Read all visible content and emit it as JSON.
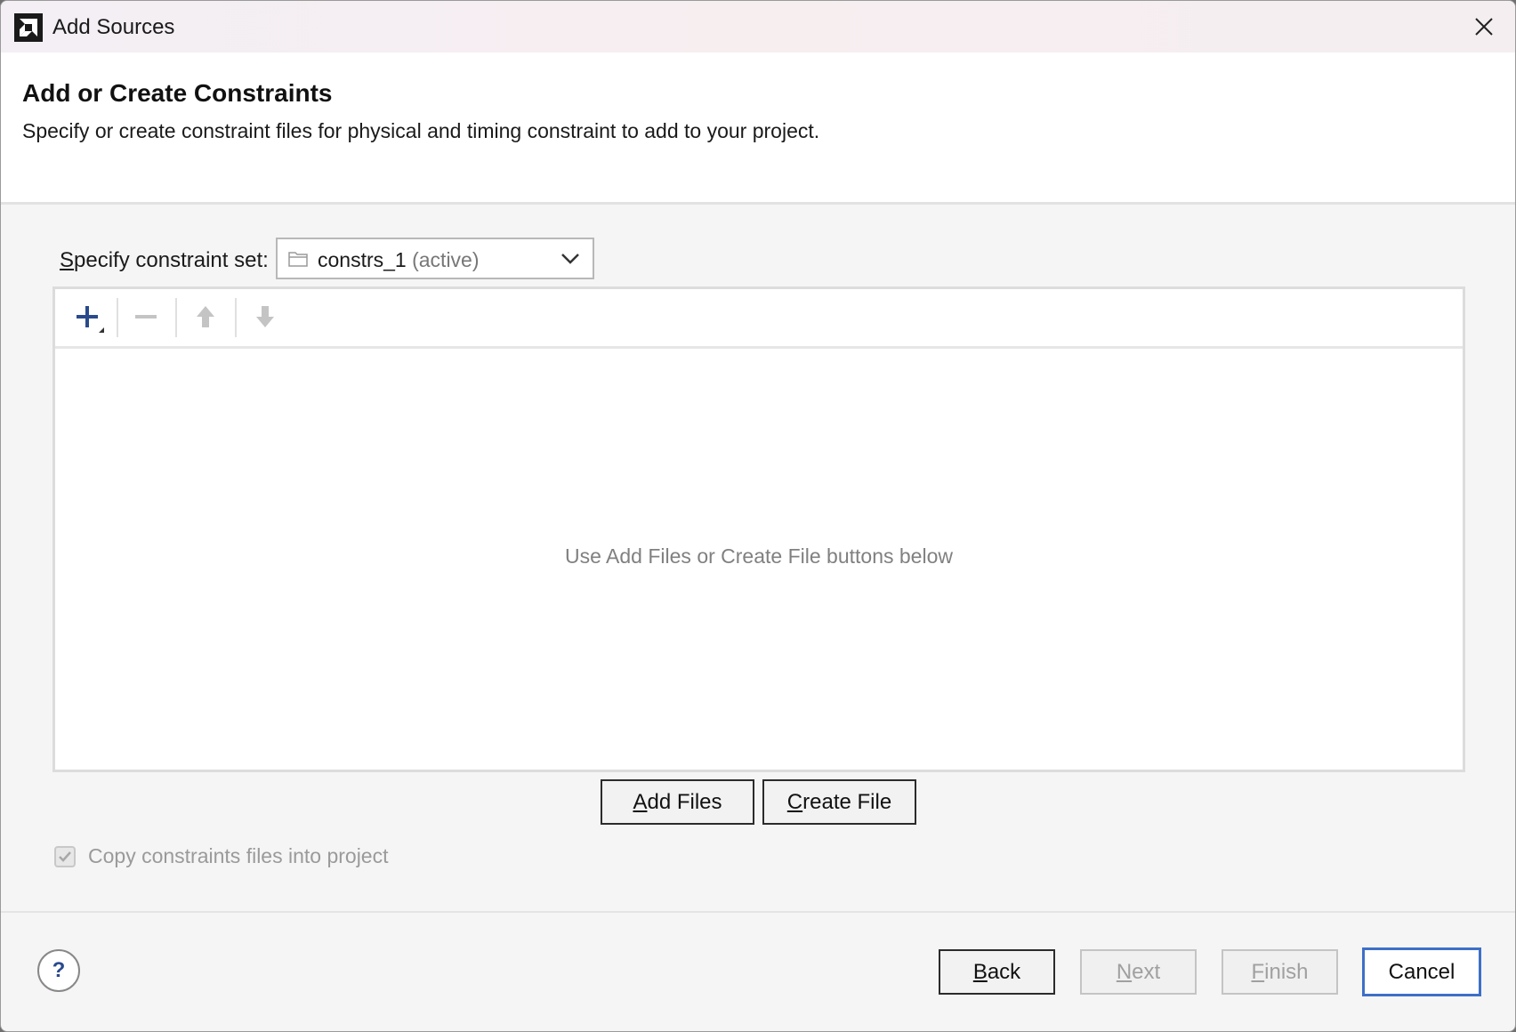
{
  "window": {
    "title": "Add Sources",
    "logo_icon": "amd-logo-icon",
    "close_icon": "close-icon"
  },
  "header": {
    "title": "Add or Create Constraints",
    "description": "Specify or create constraint files for physical and timing constraint to add to your project."
  },
  "constraint_set": {
    "label_mnemonic": "S",
    "label_rest": "pecify constraint set:",
    "selected_value": "constrs_1",
    "selected_suffix": "(active)",
    "folder_icon": "folder-icon",
    "chevron_icon": "chevron-down-icon"
  },
  "toolbar": {
    "add_icon": "plus-icon",
    "remove_icon": "minus-icon",
    "move_up_icon": "arrow-up-icon",
    "move_down_icon": "arrow-down-icon"
  },
  "file_list": {
    "empty_hint": "Use Add Files or Create File buttons below"
  },
  "file_buttons": {
    "add_files_mnemonic": "A",
    "add_files_rest": "dd Files",
    "create_file_mnemonic": "C",
    "create_file_rest": "reate File"
  },
  "options": {
    "copy_checkbox_label": "Copy constraints files into project",
    "copy_checked": true
  },
  "footer": {
    "help_label": "?",
    "back_mnemonic": "B",
    "back_rest": "ack",
    "next_mnemonic": "N",
    "next_rest": "ext",
    "finish_mnemonic": "F",
    "finish_rest": "inish",
    "cancel_label": "Cancel"
  },
  "colors": {
    "accent_blue": "#3d6fc8",
    "add_icon_blue": "#2a4a8c",
    "disabled_gray": "#a0a0a0"
  }
}
